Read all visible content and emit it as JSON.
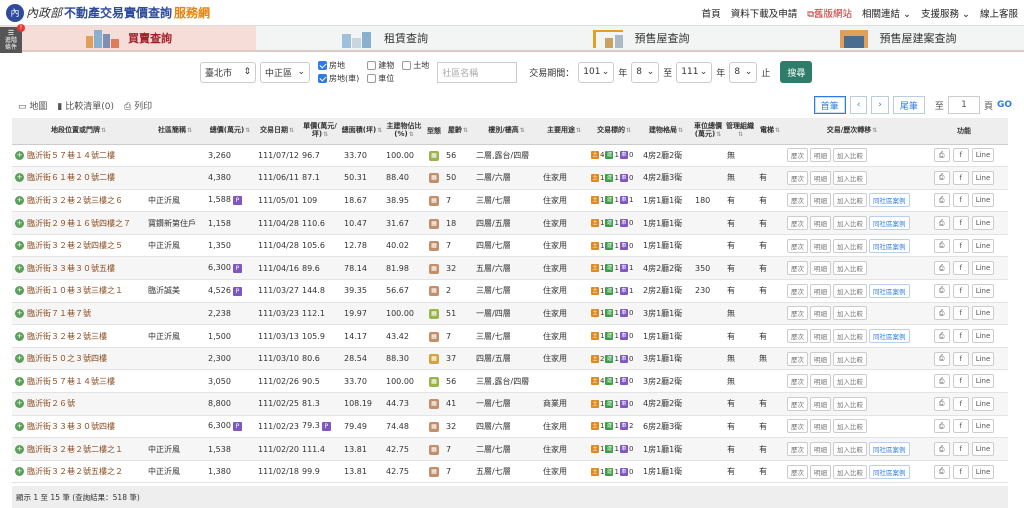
{
  "header": {
    "logo_mark": "內",
    "logo_text": "內政部",
    "brand_a": "不動產交易實價查詢",
    "brand_b": "服務網",
    "nav": [
      "首頁",
      "資料下載及申請",
      "舊版網站",
      "相關連結 ⌄",
      "支援服務 ⌄",
      "線上客服"
    ]
  },
  "side_badge": {
    "line1": "進階",
    "line2": "條件",
    "alert": "!"
  },
  "tabs": [
    {
      "label": "買賣查詢",
      "active": true
    },
    {
      "label": "租賃查詢"
    },
    {
      "label": "預售屋查詢"
    },
    {
      "label": "預售屋建案查詢"
    }
  ],
  "filter": {
    "city": "臺北市",
    "district": "中正區",
    "checks": [
      {
        "label": "房地",
        "on": true
      },
      {
        "label": "建物",
        "on": false
      },
      {
        "label": "土地",
        "on": false
      },
      {
        "label": "房地(車)",
        "on": true
      },
      {
        "label": "車位",
        "on": false
      }
    ],
    "community_placeholder": "社區名稱",
    "period_label": "交易期間：",
    "y1": "101",
    "m1": "8",
    "to": "至",
    "y2": "111",
    "m2": "8",
    "year_unit": "年",
    "end": "止",
    "search": "搜尋"
  },
  "tools": {
    "map": "地圖",
    "compare": "比較清單(0)",
    "print": "列印"
  },
  "pager": {
    "first": "首筆",
    "prev": "‹",
    "next": "›",
    "last": "尾筆",
    "to": "至",
    "page": "1",
    "unit": "頁",
    "go": "GO"
  },
  "columns": [
    "地段位置或門牌",
    "社區簡稱",
    "總價(萬元)",
    "交易日期",
    "單價(萬元/坪)",
    "總面積(坪)",
    "主建物佔比(%)",
    "型態",
    "屋齡",
    "樓別/樓高",
    "主要用途",
    "交易標的",
    "建物格局",
    "車位總價(萬元)",
    "管理組織",
    "電梯",
    "交易/歷次轉移",
    "功能"
  ],
  "action_labels": {
    "history": "歷次",
    "detail": "明細",
    "compare": "加入比較",
    "same": "同社區案例",
    "line": "Line",
    "fb": "f"
  },
  "rows": [
    {
      "addr": "臨沂街５７巷１４號二樓",
      "comm": "",
      "price": "3,260",
      "ptag": false,
      "date": "111/07/12",
      "unit": "96.7",
      "area": "33.70",
      "ratio": "100.00",
      "type": "g",
      "age": "56",
      "floor": "二層,露台/四層",
      "use": "",
      "bd": [
        "4",
        "1",
        "0"
      ],
      "layout": "4房2廳2衛",
      "park": "",
      "mgmt": "無",
      "elev": "",
      "same": false
    },
    {
      "addr": "臨沂街６１巷２０號二樓",
      "comm": "",
      "price": "4,380",
      "ptag": false,
      "date": "111/06/11",
      "unit": "87.1",
      "area": "50.31",
      "ratio": "88.40",
      "type": "h",
      "age": "50",
      "floor": "二層/六層",
      "use": "住家用",
      "bd": [
        "1",
        "1",
        "0"
      ],
      "layout": "4房2廳3衛",
      "park": "",
      "mgmt": "無",
      "elev": "有",
      "same": false
    },
    {
      "addr": "臨沂街３２巷２號三樓之６",
      "comm": "中正沂風",
      "price": "1,588",
      "ptag": true,
      "date": "111/05/01",
      "unit": "109",
      "area": "18.67",
      "ratio": "38.95",
      "type": "h",
      "age": "7",
      "floor": "三層/七層",
      "use": "住家用",
      "bd": [
        "1",
        "1",
        "1"
      ],
      "layout": "1房1廳1衛",
      "park": "180",
      "mgmt": "有",
      "elev": "有",
      "same": true
    },
    {
      "addr": "臨沂街２９巷１６號四樓之７",
      "comm": "寶鑽新第住戶",
      "price": "1,158",
      "ptag": false,
      "date": "111/04/28",
      "unit": "110.6",
      "area": "10.47",
      "ratio": "31.67",
      "type": "h",
      "age": "18",
      "floor": "四層/五層",
      "use": "住家用",
      "bd": [
        "1",
        "1",
        "0"
      ],
      "layout": "1房1廳1衛",
      "park": "",
      "mgmt": "有",
      "elev": "有",
      "same": true
    },
    {
      "addr": "臨沂街３２巷２號四樓之５",
      "comm": "中正沂風",
      "price": "1,350",
      "ptag": false,
      "date": "111/04/28",
      "unit": "105.6",
      "area": "12.78",
      "ratio": "40.02",
      "type": "h",
      "age": "7",
      "floor": "四層/七層",
      "use": "住家用",
      "bd": [
        "1",
        "1",
        "0"
      ],
      "layout": "1房1廳1衛",
      "park": "",
      "mgmt": "有",
      "elev": "有",
      "same": true
    },
    {
      "addr": "臨沂街３３巷３０號五樓",
      "comm": "",
      "price": "6,300",
      "ptag": true,
      "date": "111/04/16",
      "unit": "89.6",
      "area": "78.14",
      "ratio": "81.98",
      "type": "h",
      "age": "32",
      "floor": "五層/六層",
      "use": "住家用",
      "bd": [
        "1",
        "1",
        "1"
      ],
      "layout": "4房2廳2衛",
      "park": "350",
      "mgmt": "有",
      "elev": "有",
      "same": false
    },
    {
      "addr": "臨沂街１０巷３號三樓之１",
      "comm": "臨沂誠美",
      "price": "4,526",
      "ptag": true,
      "date": "111/03/27",
      "unit": "144.8",
      "area": "39.35",
      "ratio": "56.67",
      "type": "h",
      "age": "2",
      "floor": "三層/七層",
      "use": "住家用",
      "bd": [
        "1",
        "1",
        "1"
      ],
      "layout": "2房2廳1衛",
      "park": "230",
      "mgmt": "有",
      "elev": "有",
      "same": true
    },
    {
      "addr": "臨沂街７１巷７號",
      "comm": "",
      "price": "2,238",
      "ptag": false,
      "date": "111/03/23",
      "unit": "112.1",
      "area": "19.97",
      "ratio": "100.00",
      "type": "g",
      "age": "51",
      "floor": "一層/四層",
      "use": "住家用",
      "bd": [
        "1",
        "1",
        "0"
      ],
      "layout": "3房1廳1衛",
      "park": "",
      "mgmt": "無",
      "elev": "",
      "same": false
    },
    {
      "addr": "臨沂街３２巷２號三樓",
      "comm": "中正沂風",
      "price": "1,500",
      "ptag": false,
      "date": "111/03/13",
      "unit": "105.9",
      "area": "14.17",
      "ratio": "43.42",
      "type": "h",
      "age": "7",
      "floor": "三層/七層",
      "use": "住家用",
      "bd": [
        "1",
        "1",
        "0"
      ],
      "layout": "1房1廳1衛",
      "park": "",
      "mgmt": "有",
      "elev": "有",
      "same": true
    },
    {
      "addr": "臨沂街５０之３號四樓",
      "comm": "",
      "price": "2,300",
      "ptag": false,
      "date": "111/03/10",
      "unit": "80.6",
      "area": "28.54",
      "ratio": "88.30",
      "type": "a",
      "age": "37",
      "floor": "四層/五層",
      "use": "住家用",
      "bd": [
        "2",
        "1",
        "0"
      ],
      "layout": "3房1廳1衛",
      "park": "",
      "mgmt": "無",
      "elev": "無",
      "same": false
    },
    {
      "addr": "臨沂街５７巷１４號三樓",
      "comm": "",
      "price": "3,050",
      "ptag": false,
      "date": "111/02/26",
      "unit": "90.5",
      "area": "33.70",
      "ratio": "100.00",
      "type": "g",
      "age": "56",
      "floor": "三層,露台/四層",
      "use": "",
      "bd": [
        "4",
        "1",
        "0"
      ],
      "layout": "3房2廳2衛",
      "park": "",
      "mgmt": "無",
      "elev": "",
      "same": false
    },
    {
      "addr": "臨沂街２６號",
      "comm": "",
      "price": "8,800",
      "ptag": false,
      "date": "111/02/25",
      "unit": "81.3",
      "area": "108.19",
      "ratio": "44.73",
      "type": "h",
      "age": "41",
      "floor": "一層/七層",
      "use": "商業用",
      "bd": [
        "1",
        "1",
        "0"
      ],
      "layout": "4房2廳2衛",
      "park": "",
      "mgmt": "有",
      "elev": "有",
      "same": false
    },
    {
      "addr": "臨沂街３３巷３０號四樓",
      "comm": "",
      "price": "6,300",
      "ptag": true,
      "date": "111/02/23",
      "unit": "79.3",
      "ptag2": true,
      "area": "79.49",
      "ratio": "74.48",
      "type": "h",
      "age": "32",
      "floor": "四層/六層",
      "use": "住家用",
      "bd": [
        "1",
        "1",
        "2"
      ],
      "layout": "6房2廳3衛",
      "park": "",
      "mgmt": "有",
      "elev": "有",
      "same": false
    },
    {
      "addr": "臨沂街３２巷２號二樓之１",
      "comm": "中正沂風",
      "price": "1,538",
      "ptag": false,
      "date": "111/02/20",
      "unit": "111.4",
      "area": "13.81",
      "ratio": "42.75",
      "type": "h",
      "age": "7",
      "floor": "二層/七層",
      "use": "住家用",
      "bd": [
        "1",
        "1",
        "0"
      ],
      "layout": "1房1廳1衛",
      "park": "",
      "mgmt": "有",
      "elev": "有",
      "same": true
    },
    {
      "addr": "臨沂街３２巷２號五樓之２",
      "comm": "中正沂風",
      "price": "1,380",
      "ptag": false,
      "date": "111/02/18",
      "unit": "99.9",
      "area": "13.81",
      "ratio": "42.75",
      "type": "h",
      "age": "7",
      "floor": "五層/七層",
      "use": "住家用",
      "bd": [
        "1",
        "1",
        "0"
      ],
      "layout": "1房1廳1衛",
      "park": "",
      "mgmt": "有",
      "elev": "有",
      "same": true
    }
  ],
  "footer": "顯示 1 至 15 筆 (查詢結果：518 筆)"
}
